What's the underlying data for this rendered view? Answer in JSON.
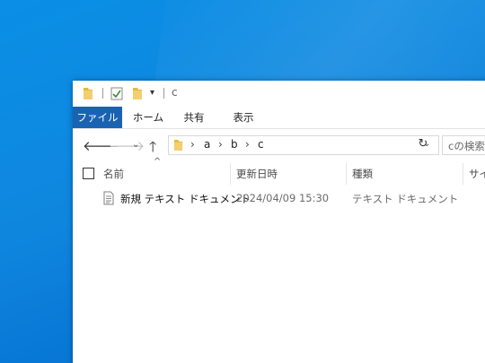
{
  "window": {
    "title": "c"
  },
  "ribbon": {
    "tabs": [
      {
        "label": "ファイル",
        "active": true
      },
      {
        "label": "ホーム"
      },
      {
        "label": "共有"
      },
      {
        "label": "表示"
      }
    ]
  },
  "address_bar": {
    "breadcrumbs": [
      "a",
      "b",
      "c"
    ]
  },
  "search": {
    "placeholder": "cの検索"
  },
  "columns": {
    "name": "名前",
    "modified": "更新日時",
    "type": "種類",
    "size": "サイ"
  },
  "files": [
    {
      "name": "新規 テキスト ドキュメント",
      "modified": "2024/04/09 15:30",
      "type": "テキスト ドキュメント",
      "icon": "text-document-icon"
    }
  ],
  "colors": {
    "desktop": "#0f86de",
    "file_tab": "#1a63b3",
    "folder": "#e8b64a"
  }
}
